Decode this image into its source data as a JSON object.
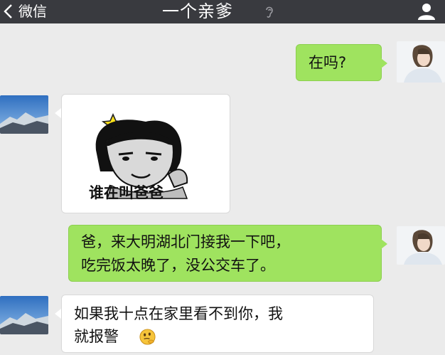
{
  "header": {
    "back_label": "微信",
    "title": "一个亲爹",
    "back_icon": "chevron-left-icon",
    "ear_icon": "ear-icon",
    "profile_icon": "person-icon",
    "bar_color": "#393a3f"
  },
  "messages": [
    {
      "side": "right",
      "type": "text",
      "lines": [
        "在吗?"
      ]
    },
    {
      "side": "left",
      "type": "sticker",
      "sticker_caption": "谁在叫爸爸"
    },
    {
      "side": "right",
      "type": "text",
      "lines": [
        "爸，来大明湖北门接我一下吧，",
        "吃完饭太晚了，没公交车了。"
      ]
    },
    {
      "side": "left",
      "type": "text",
      "lines": [
        "如果我十点在家里看不到你，我",
        "就报警"
      ],
      "emoji": "thinking-emoji"
    }
  ],
  "colors": {
    "background": "#ebebeb",
    "outgoing_bubble": "#9fe35f",
    "incoming_bubble": "#ffffff"
  }
}
